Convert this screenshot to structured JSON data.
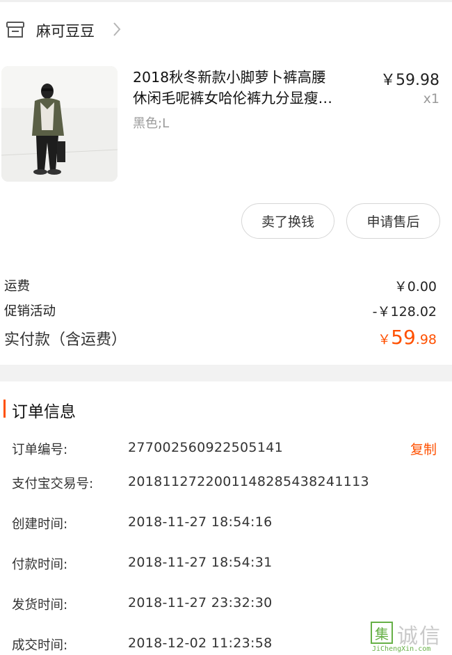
{
  "shop": {
    "name": "麻可豆豆",
    "icon": "store-icon",
    "chevron": "chevron-right-icon"
  },
  "product": {
    "title_line1": "2018秋冬新款小脚萝卜裤高腰",
    "title_line2": "休闲毛呢裤女哈伦裤九分显瘦…",
    "spec": "黑色;L",
    "price": "￥59.98",
    "quantity": "x1"
  },
  "actions": {
    "sell": "卖了换钱",
    "after_sale": "申请售后"
  },
  "costs": {
    "shipping_label": "运费",
    "shipping_value": "￥0.00",
    "promo_label": "促销活动",
    "promo_value": "-￥128.02",
    "paid_label": "实付款（含运费）",
    "paid_currency": "￥",
    "paid_integer": "59",
    "paid_decimal": ".98"
  },
  "order_info": {
    "title": "订单信息",
    "copy_label": "复制",
    "rows": [
      {
        "label": "订单编号:",
        "value": "277002560922505141"
      },
      {
        "label": "支付宝交易号:",
        "value": "2018112722001148285438241113"
      },
      {
        "label": "创建时间:",
        "value": "2018-11-27 18:54:16"
      },
      {
        "label": "付款时间:",
        "value": "2018-11-27 18:54:31"
      },
      {
        "label": "发货时间:",
        "value": "2018-11-27 23:32:30"
      },
      {
        "label": "成交时间:",
        "value": "2018-12-02 11:23:58"
      }
    ]
  },
  "watermark": {
    "logo_char": "集",
    "text": "诚信",
    "url": "JiChengXin.com"
  },
  "colors": {
    "accent": "#ff5000",
    "watermark_green": "#66b046"
  }
}
